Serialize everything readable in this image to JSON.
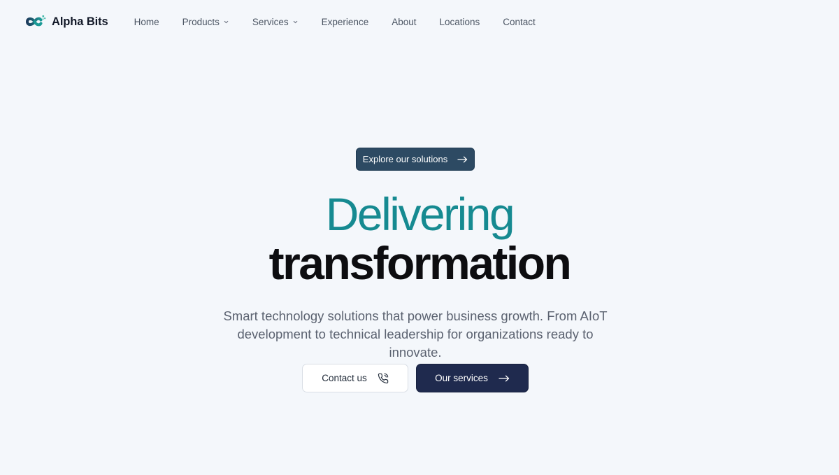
{
  "brand": {
    "name": "Alpha Bits",
    "logo_icon": "alpha-bits-logo-icon"
  },
  "nav": {
    "items": [
      {
        "label": "Home",
        "has_dropdown": false
      },
      {
        "label": "Products",
        "has_dropdown": true
      },
      {
        "label": "Services",
        "has_dropdown": true
      },
      {
        "label": "Experience",
        "has_dropdown": false
      },
      {
        "label": "About",
        "has_dropdown": false
      },
      {
        "label": "Locations",
        "has_dropdown": false
      },
      {
        "label": "Contact",
        "has_dropdown": false
      }
    ]
  },
  "hero": {
    "badge_label": "Explore our solutions",
    "headline_line1": "Delivering",
    "headline_line2": "transformation",
    "subtitle_line1": "Smart technology solutions that power business growth. From AIoT",
    "subtitle_line2": "development to technical leadership for organizations ready to innovate.",
    "primary_cta": "Contact us",
    "secondary_cta": "Our services"
  },
  "colors": {
    "background": "#f4f7fb",
    "accent_teal": "#168a91",
    "badge_bg": "#2d4a63",
    "navy_button": "#1f2a4e",
    "headline_dark": "#0d0d10"
  }
}
